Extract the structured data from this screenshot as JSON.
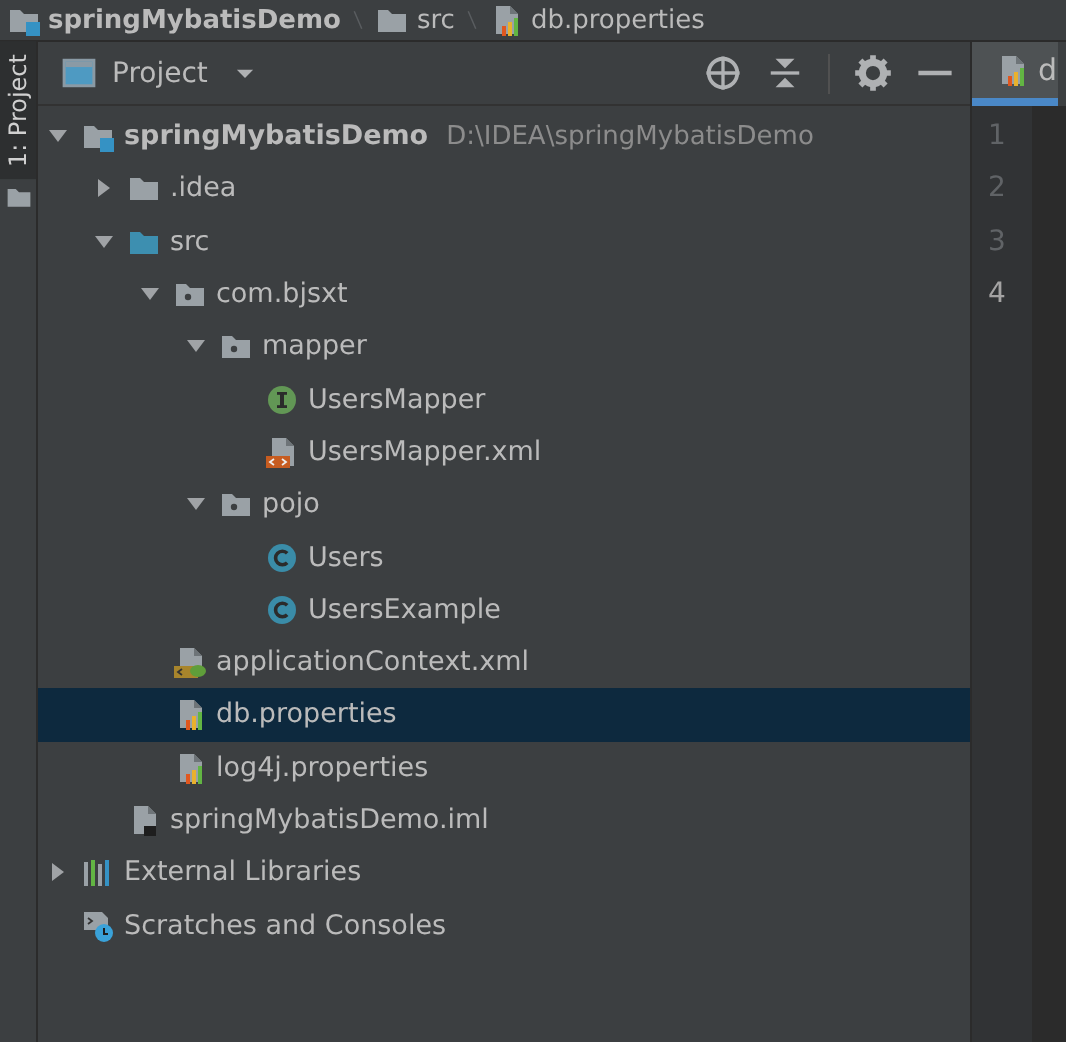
{
  "breadcrumbs": [
    {
      "text": "springMybatisDemo",
      "kind": "module"
    },
    {
      "text": "src",
      "kind": "folder"
    },
    {
      "text": "db.properties",
      "kind": "properties"
    }
  ],
  "side_tab": {
    "label": "1: Project",
    "selected": true
  },
  "panel": {
    "title": "Project"
  },
  "tree": [
    {
      "label": "springMybatisDemo",
      "path": "D:\\IDEA\\springMybatisDemo",
      "kind": "module",
      "expanded": true,
      "selected": false,
      "children": [
        {
          "label": ".idea",
          "kind": "folder",
          "expanded": false,
          "selected": false
        },
        {
          "label": "src",
          "kind": "source-folder",
          "expanded": true,
          "selected": false,
          "children": [
            {
              "label": "com.bjsxt",
              "kind": "package",
              "expanded": true,
              "selected": false,
              "children": [
                {
                  "label": "mapper",
                  "kind": "package",
                  "expanded": true,
                  "selected": false,
                  "children": [
                    {
                      "label": "UsersMapper",
                      "kind": "interface",
                      "selected": false
                    },
                    {
                      "label": "UsersMapper.xml",
                      "kind": "xml",
                      "selected": false
                    }
                  ]
                },
                {
                  "label": "pojo",
                  "kind": "package",
                  "expanded": true,
                  "selected": false,
                  "children": [
                    {
                      "label": "Users",
                      "kind": "class",
                      "selected": false
                    },
                    {
                      "label": "UsersExample",
                      "kind": "class",
                      "selected": false
                    }
                  ]
                }
              ]
            },
            {
              "label": "applicationContext.xml",
              "kind": "spring-xml",
              "selected": false
            },
            {
              "label": "db.properties",
              "kind": "properties",
              "selected": true
            },
            {
              "label": "log4j.properties",
              "kind": "properties",
              "selected": false
            }
          ]
        },
        {
          "label": "springMybatisDemo.iml",
          "kind": "iml",
          "selected": false
        }
      ]
    },
    {
      "label": "External Libraries",
      "kind": "libraries",
      "expanded": false,
      "selected": false
    },
    {
      "label": "Scratches and Consoles",
      "kind": "scratches",
      "selected": false
    }
  ],
  "editor": {
    "tab": {
      "label": "d",
      "kind": "properties",
      "selected": true
    },
    "lines": [
      {
        "number": "1",
        "current": false
      },
      {
        "number": "2",
        "current": false
      },
      {
        "number": "3",
        "current": false
      },
      {
        "number": "4",
        "current": true
      }
    ]
  }
}
